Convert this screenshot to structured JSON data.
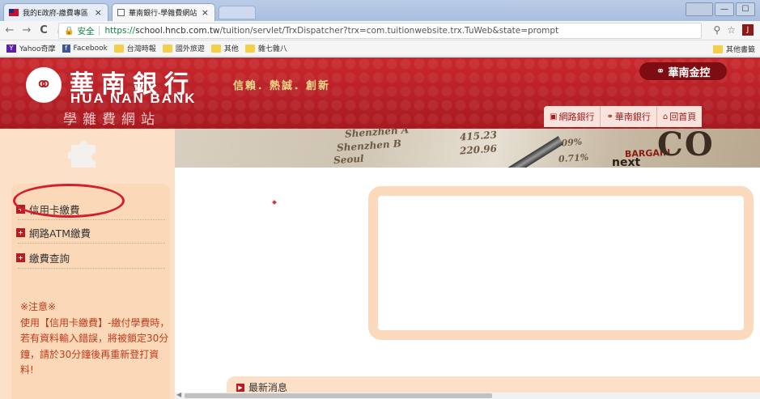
{
  "browser": {
    "tabs": [
      {
        "label": "我的E政府-繳費專區",
        "active": false
      },
      {
        "label": "華南銀行-學雜費網站",
        "active": true
      }
    ],
    "tab_close": "×",
    "window_buttons": [
      "—",
      "☐",
      "✕"
    ],
    "address": {
      "secure_label": "安全",
      "url_scheme": "https://",
      "url_host": "school.hncb.com.tw",
      "url_path": "/tuition/servlet/TrxDispatcher?trx=com.tuitionwebsite.trx.TuWeb&state=prompt"
    },
    "nav": {
      "back": "←",
      "forward": "→",
      "reload": "C",
      "home": "⌂"
    },
    "toolbar_icons": [
      "zoom-icon",
      "star-icon",
      "extension-icon"
    ],
    "bookmarks": [
      {
        "label": "Yahoo奇摩",
        "icon": "yahoo-icon",
        "color": "#5f1ea8"
      },
      {
        "label": "Facebook",
        "icon": "facebook-icon",
        "color": "#3b5998"
      },
      {
        "label": "台灣時報",
        "icon": "folder-icon"
      },
      {
        "label": "國外旅遊",
        "icon": "folder-icon"
      },
      {
        "label": "其他",
        "icon": "folder-icon"
      },
      {
        "label": "雜七雜八",
        "icon": "folder-icon"
      }
    ],
    "other_bookmarks": "其他書籤"
  },
  "site": {
    "brand_cn": "華南銀行",
    "brand_en": "HUA NAN BANK",
    "brand_sub": "學雜費網站",
    "slogan": "信賴．熱誠．創新",
    "group_logo": "華南金控",
    "top_links": [
      {
        "label": "網路銀行",
        "icon": "monitor-icon"
      },
      {
        "label": "華南銀行",
        "icon": "hncb-logo-icon"
      },
      {
        "label": "回首頁",
        "icon": "home-icon"
      }
    ],
    "banner_texts": {
      "row1_name": "Shenzhen A",
      "row1_val": "415.23",
      "row2_name": "Shenzhen B",
      "row2_val": "220.96",
      "row3_name": "Seoul",
      "row3_val": "0.71%",
      "pct1": "0.09%",
      "bargain": "BARGAIN",
      "next": "next",
      "big": "CO"
    },
    "menu": [
      {
        "label": "信用卡繳費"
      },
      {
        "label": "網路ATM繳費"
      },
      {
        "label": "繳費查詢"
      }
    ],
    "notice_title": "※注意※",
    "notice_body": "使用【信用卡繳費】-繳付學費時，若有資料輸入錯誤，將被鎖定30分鐘，請於30分鐘後再重新登打資料!",
    "news_title": "最新消息"
  },
  "colors": {
    "header_red": "#b01f25",
    "sidebar_peach": "#fde0c8",
    "highlight_circle": "#d21f2a",
    "notice_text": "#c23a1e"
  }
}
